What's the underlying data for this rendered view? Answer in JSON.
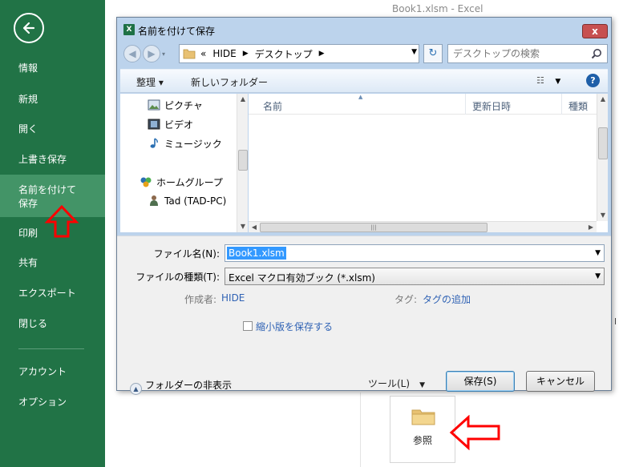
{
  "backstage": {
    "window_title": "Book1.xlsm - Excel",
    "nav_items": [
      {
        "label": "情報"
      },
      {
        "label": "新規"
      },
      {
        "label": "開く"
      },
      {
        "label": "上書き保存"
      },
      {
        "label": "名前を付けて\n保存",
        "selected": true
      },
      {
        "label": "印刷"
      },
      {
        "label": "共有"
      },
      {
        "label": "エクスポート"
      },
      {
        "label": "閉じる"
      },
      {
        "label": "アカウント"
      },
      {
        "label": "オプション"
      }
    ],
    "browse_label": "参照",
    "right_edge_char": "l"
  },
  "dialog": {
    "title": "名前を付けて保存",
    "close_label": "x",
    "address": {
      "prefix": "«",
      "parts": [
        "HIDE",
        "デスクトップ"
      ]
    },
    "search_placeholder": "デスクトップの検索",
    "toolbar": {
      "organize_label": "整理 ▾",
      "new_folder_label": "新しいフォルダー",
      "help_label": "?"
    },
    "nav_tree": [
      {
        "label": "ピクチャ",
        "icon": "pictures-icon"
      },
      {
        "label": "ビデオ",
        "icon": "videos-icon"
      },
      {
        "label": "ミュージック",
        "icon": "music-icon"
      },
      {
        "label": "ホームグループ",
        "icon": "homegroup-icon"
      },
      {
        "label": "Tad (TAD-PC)",
        "icon": "user-icon"
      }
    ],
    "columns": [
      "名前",
      "更新日時",
      "種類"
    ],
    "filename_label": "ファイル名(N):",
    "filename_value": "Book1.xlsm",
    "filetype_label": "ファイルの種類(T):",
    "filetype_value": "Excel マクロ有効ブック (*.xlsm)",
    "author_label": "作成者:",
    "author_value": "HIDE",
    "tags_label": "タグ:",
    "tags_value": "タグの追加",
    "thumbnail_label": "縮小版を保存する",
    "hide_folders_label": "フォルダーの非表示",
    "tools_label": "ツール(L)",
    "save_label": "保存(S)",
    "cancel_label": "キャンセル"
  },
  "colors": {
    "backstage_green": "#217346",
    "selected_nav": "#439467",
    "annotation_red": "#ff0000",
    "link_blue": "#2f62b4"
  }
}
